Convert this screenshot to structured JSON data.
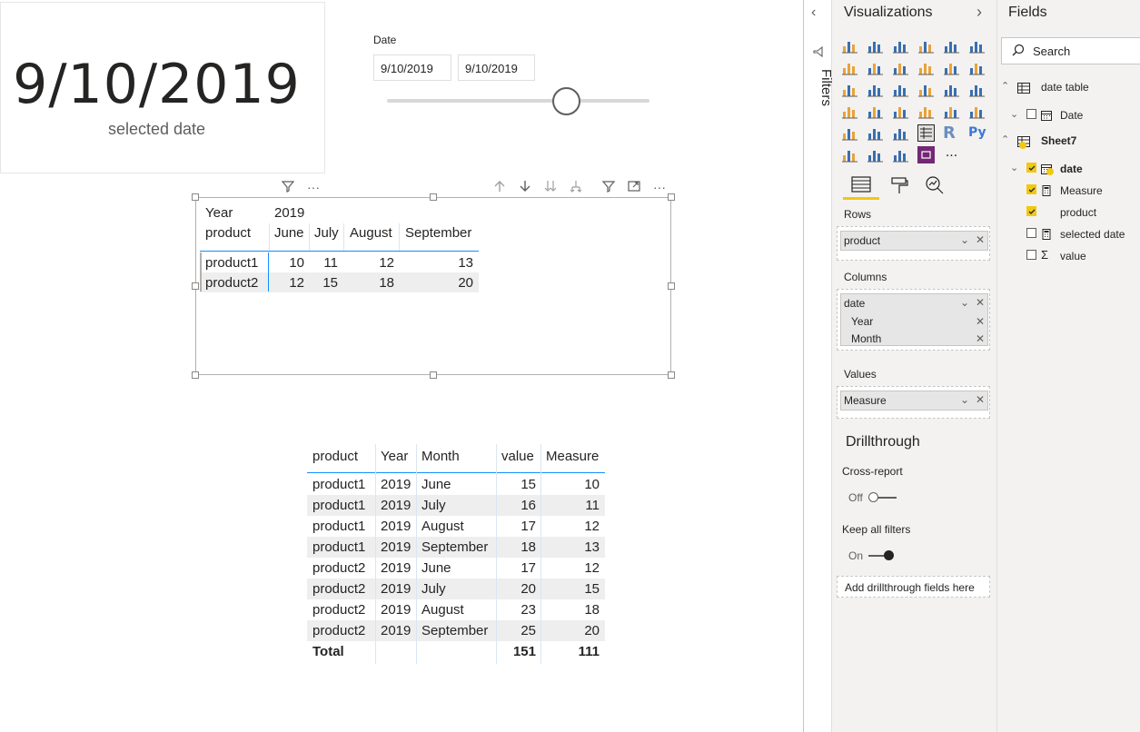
{
  "card": {
    "value": "9/10/2019",
    "label": "selected date"
  },
  "slicer": {
    "title": "Date",
    "start": "9/10/2019",
    "end": "9/10/2019",
    "position": 0.68
  },
  "matrix": {
    "year_label": "Year",
    "year_value": "2019",
    "row_header": "product",
    "months": [
      "June",
      "July",
      "August",
      "September"
    ],
    "rows": [
      {
        "product": "product1",
        "values": [
          "10",
          "11",
          "12",
          "13"
        ]
      },
      {
        "product": "product2",
        "values": [
          "12",
          "15",
          "18",
          "20"
        ]
      }
    ]
  },
  "table": {
    "columns": [
      "product",
      "Year",
      "Month",
      "value",
      "Measure"
    ],
    "rows": [
      [
        "product1",
        "2019",
        "June",
        "15",
        "10"
      ],
      [
        "product1",
        "2019",
        "July",
        "16",
        "11"
      ],
      [
        "product1",
        "2019",
        "August",
        "17",
        "12"
      ],
      [
        "product1",
        "2019",
        "September",
        "18",
        "13"
      ],
      [
        "product2",
        "2019",
        "June",
        "17",
        "12"
      ],
      [
        "product2",
        "2019",
        "July",
        "20",
        "15"
      ],
      [
        "product2",
        "2019",
        "August",
        "23",
        "18"
      ],
      [
        "product2",
        "2019",
        "September",
        "25",
        "20"
      ]
    ],
    "total": {
      "label": "Total",
      "value": "151",
      "measure": "111"
    }
  },
  "filters": {
    "label": "Filters"
  },
  "visualizations": {
    "title": "Visualizations",
    "rows_label": "Rows",
    "rows_field": "product",
    "columns_label": "Columns",
    "columns_fields": [
      "date",
      "Year",
      "Month"
    ],
    "values_label": "Values",
    "values_field": "Measure",
    "drillthrough_title": "Drillthrough",
    "cross_report_label": "Cross-report",
    "cross_report_state": "Off",
    "keep_filters_label": "Keep all filters",
    "keep_filters_state": "On",
    "drop_hint": "Add drillthrough fields here",
    "more_label": "..."
  },
  "fields": {
    "title": "Fields",
    "search_placeholder": "Search",
    "tables": [
      {
        "name": "date table",
        "items": [
          {
            "name": "Date",
            "checked": false
          }
        ]
      },
      {
        "name": "Sheet7",
        "items": [
          {
            "name": "date",
            "checked": true
          },
          {
            "name": "Measure",
            "checked": true
          },
          {
            "name": "product",
            "checked": true
          },
          {
            "name": "selected date",
            "checked": false
          },
          {
            "name": "value",
            "checked": false
          }
        ]
      }
    ]
  },
  "colors": {
    "accent": "#f2c811",
    "selection_blue": "#118dff",
    "pane_bg": "#f3f2f1",
    "r_blue": "#6c8ebf",
    "py_blue": "#3c78d8"
  }
}
